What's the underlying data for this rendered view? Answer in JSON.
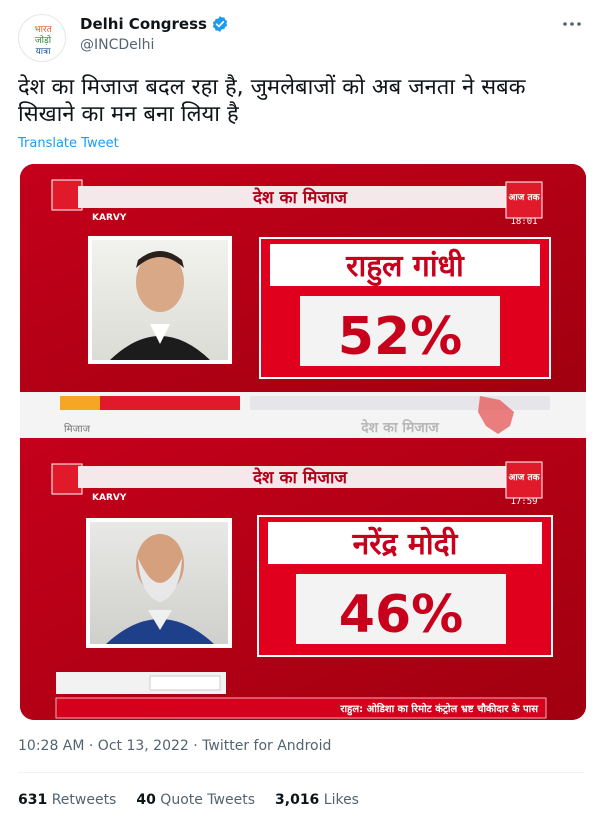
{
  "account": {
    "name": "Delhi Congress",
    "handle": "@INCDelhi",
    "avatar_text": [
      "भारत",
      "जोड़ो",
      "यात्रा"
    ]
  },
  "tweet": {
    "text": "देश का मिजाज बदल रहा है, जुमलेबाजों को अब जनता ने सबक सिखाने का मन बना लिया है",
    "translate_label": "Translate Tweet",
    "meta": "10:28 AM · Oct 13, 2022 · Twitter for Android"
  },
  "media": {
    "top_panel": {
      "banner": "देश का मिजाज",
      "name": "राहुल गांधी",
      "percent": "52%",
      "sponsor": "KARVY",
      "time": "18:01",
      "channel": "आज तक"
    },
    "mid_strip": {
      "left": "मिजाज",
      "right": "देश का मिजाज"
    },
    "bottom_panel": {
      "banner": "देश का मिजाज",
      "name": "नरेंद्र मोदी",
      "percent": "46%",
      "sponsor": "KARVY",
      "time": "17:59",
      "channel": "आज तक"
    },
    "ticker": "राहुल: ओडिशा का रिमोट कंट्रोल भ्रष्ट चौकीदार के पास"
  },
  "stats": {
    "retweets_count": "631",
    "retweets_label": "Retweets",
    "quotes_count": "40",
    "quotes_label": "Quote Tweets",
    "likes_count": "3,016",
    "likes_label": "Likes"
  },
  "colors": {
    "link_blue": "#1d9bf0",
    "verified_blue": "#1d9bf0",
    "panel_red": "#c4001a"
  },
  "icons": [
    "verified-badge-icon",
    "more-icon"
  ]
}
